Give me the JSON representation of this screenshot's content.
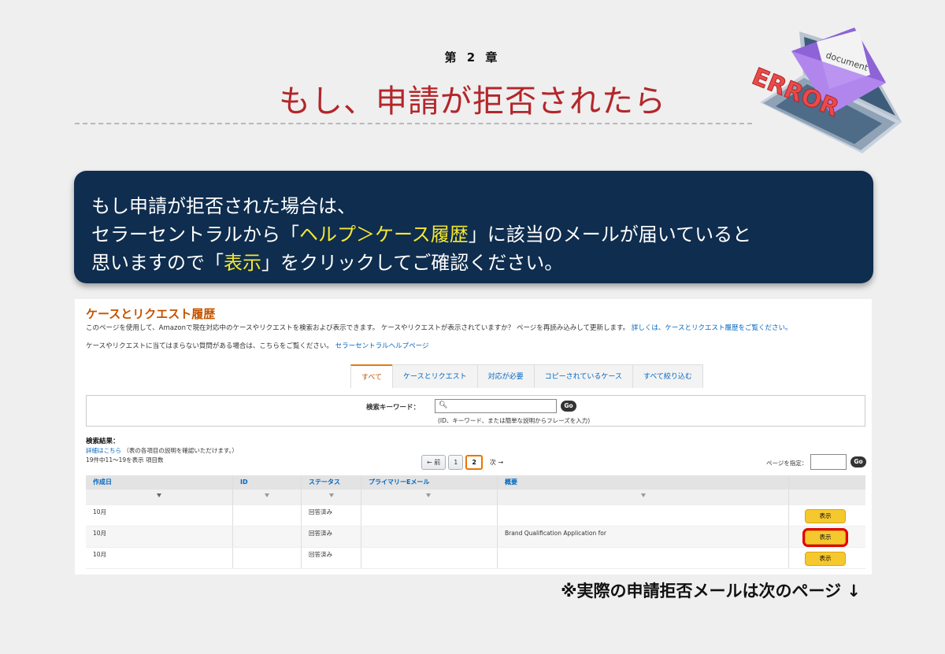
{
  "chapter": "第 2 章",
  "title": "もし、申請が拒否されたら",
  "illustration": {
    "doc_label": "document",
    "error_label": "ERROR"
  },
  "callout": {
    "line1": "もし申請が拒否された場合は、",
    "line2_pre": "セラーセントラルから「",
    "line2_hl": "ヘルプ＞ケース履歴",
    "line2_post": "」に該当のメールが届いていると",
    "line3_pre": "思いますので「",
    "line3_hl": "表示",
    "line3_post": "」をクリックしてご確認ください。"
  },
  "screenshot": {
    "heading": "ケースとリクエスト履歴",
    "intro": "このページを使用して、Amazonで現在対応中のケースやリクエストを検索および表示できます。 ケースやリクエストが表示されていますか？ ページを再読み込みして更新します。",
    "intro_link": "詳しくは、ケースとリクエスト履歴をご覧ください。",
    "help_text": "ケースやリクエストに当てはまらない質問がある場合は、こちらをご覧ください。",
    "help_link": "セラーセントラルヘルプページ",
    "tabs": [
      "すべて",
      "ケースとリクエスト",
      "対応が必要",
      "コピーされているケース",
      "すべて絞り込む"
    ],
    "search_label": "検索キーワード：",
    "search_value": "",
    "go_label": "Go",
    "search_hint": "(ID、キーワード、または簡単な説明からフレーズを入力)",
    "results_title": "検索結果：",
    "results_detail_link": "詳細はこちら",
    "results_detail_text": "（表の各項目の説明を確認いただけます。）",
    "results_count": "19件中11〜19を表示 項目数",
    "pager": {
      "prev": "← 前",
      "page1": "1",
      "page2": "2",
      "next": "次 →"
    },
    "page_spec_label": "ページを指定：",
    "columns": [
      "作成日",
      "ID",
      "ステータス",
      "プライマリーEメール",
      "概要",
      ""
    ],
    "rows": [
      {
        "date": "10月",
        "id": "",
        "status": "回答済み",
        "email": "",
        "summary": "",
        "action": "表示"
      },
      {
        "date": "10月",
        "id": "",
        "status": "回答済み",
        "email": "",
        "summary": "Brand Qualification Application for",
        "action": "表示"
      },
      {
        "date": "10月",
        "id": "",
        "status": "回答済み",
        "email": "",
        "summary": "",
        "action": "表示"
      }
    ]
  },
  "footer_note": "※実際の申請拒否メールは次のページ ↓",
  "colors": {
    "title": "#b3262a",
    "callout_bg": "#0f2d4e",
    "highlight": "#f6e832",
    "amazon_orange": "#c45500",
    "link": "#0066c0",
    "button": "#f5c82d",
    "marker": "#e30000"
  }
}
